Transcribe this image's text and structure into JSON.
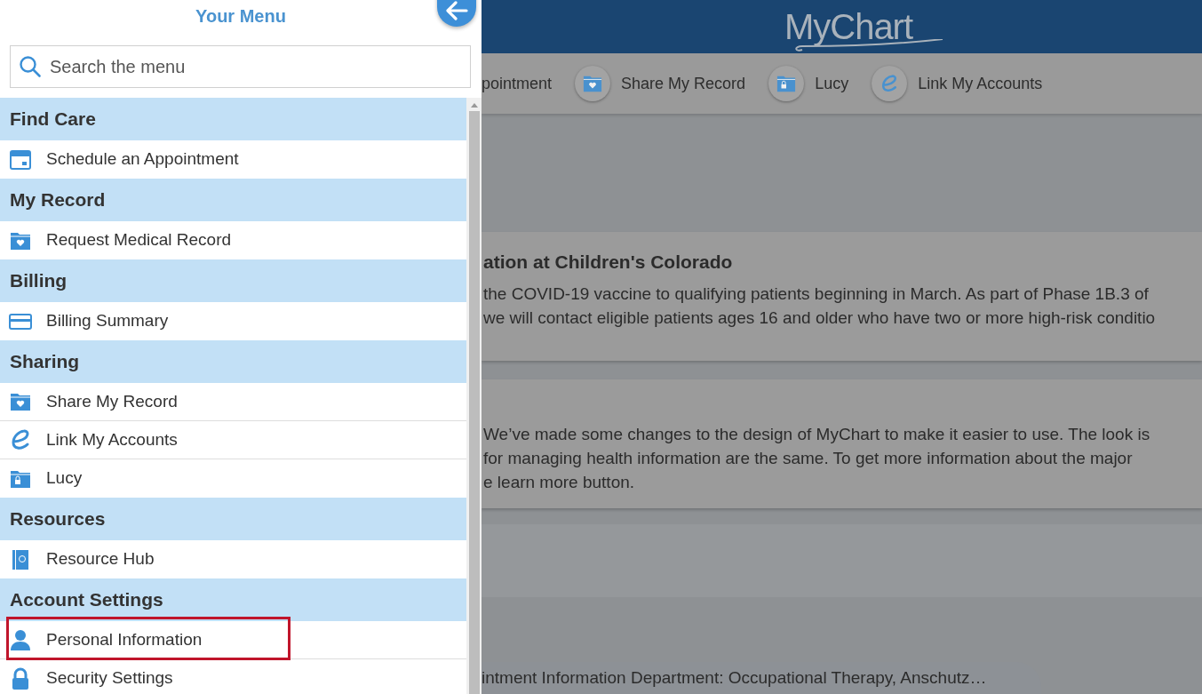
{
  "menu": {
    "title": "Your Menu",
    "search": {
      "placeholder": "Search the menu"
    },
    "sections": [
      {
        "heading": "Find Care",
        "items": [
          {
            "label": "Schedule an Appointment",
            "kind": "calendar",
            "highlighted": false
          }
        ]
      },
      {
        "heading": "My Record",
        "items": [
          {
            "label": "Request Medical Record",
            "kind": "folder",
            "highlighted": false
          }
        ]
      },
      {
        "heading": "Billing",
        "items": [
          {
            "label": "Billing Summary",
            "kind": "card",
            "highlighted": false
          }
        ]
      },
      {
        "heading": "Sharing",
        "items": [
          {
            "label": "Share My Record",
            "kind": "folder",
            "highlighted": false
          },
          {
            "label": "Link My Accounts",
            "kind": "link",
            "highlighted": false
          },
          {
            "label": "Lucy",
            "kind": "locker",
            "highlighted": false
          }
        ]
      },
      {
        "heading": "Resources",
        "items": [
          {
            "label": "Resource Hub",
            "kind": "book",
            "highlighted": false
          }
        ]
      },
      {
        "heading": "Account Settings",
        "items": [
          {
            "label": "Personal Information",
            "kind": "person",
            "highlighted": true
          },
          {
            "label": "Security Settings",
            "kind": "lock",
            "highlighted": false
          }
        ]
      }
    ]
  },
  "header": {
    "logo": "MyChart"
  },
  "shortcuts": [
    {
      "label": "pointment",
      "kind": "none"
    },
    {
      "label": "Share My Record",
      "kind": "folder"
    },
    {
      "label": "Lucy",
      "kind": "locker"
    },
    {
      "label": "Link My Accounts",
      "kind": "link"
    }
  ],
  "cards": [
    {
      "title": "ation at Children's Colorado",
      "lines": [
        "the COVID-19 vaccine to qualifying patients beginning in March. As part of Phase 1B.3 of",
        "we will contact eligible patients ages 16 and older who have two or more high-risk conditio"
      ]
    },
    {
      "lines": [
        "We’ve made some changes to the design of MyChart to make it easier to use. The look is",
        "for managing health information are the same. To get more information about the major",
        "e learn more button."
      ]
    }
  ],
  "appointment": {
    "text": "intment Information Department: Occupational Therapy, Anschutz…"
  }
}
